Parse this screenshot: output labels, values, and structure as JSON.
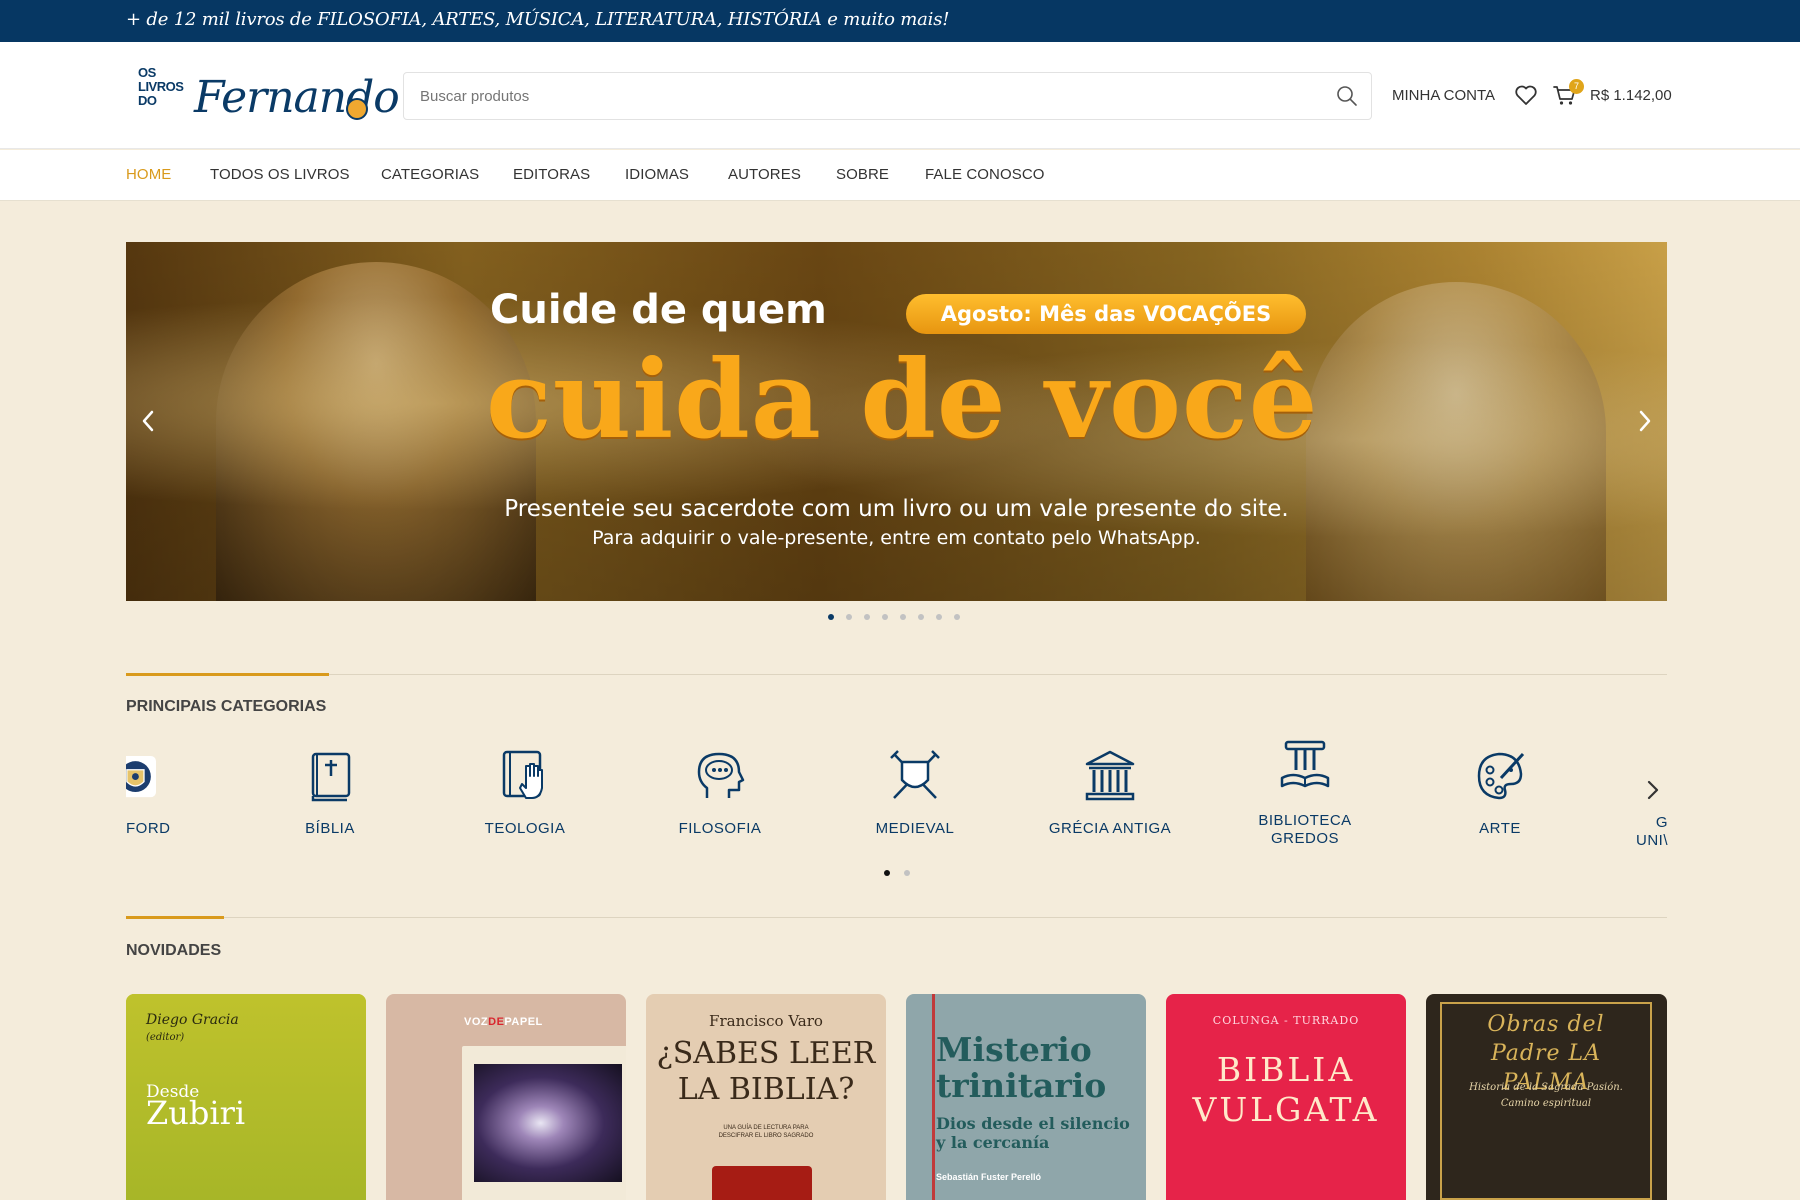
{
  "topbar": {
    "text": "+ de 12 mil livros de FILOSOFIA, ARTES, MÚSICA, LITERATURA, HISTÓRIA e muito mais!"
  },
  "logo": {
    "small": "OS LIVROS DO",
    "script": "Fernando"
  },
  "search": {
    "placeholder": "Buscar produtos",
    "value": ""
  },
  "header": {
    "account_label": "MINHA CONTA",
    "cart_count": "7",
    "cart_total": "R$ 1.142,00"
  },
  "nav": {
    "items": [
      {
        "label": "HOME",
        "active": true
      },
      {
        "label": "TODOS OS LIVROS"
      },
      {
        "label": "CATEGORIAS"
      },
      {
        "label": "EDITORAS"
      },
      {
        "label": "IDIOMAS"
      },
      {
        "label": "AUTORES"
      },
      {
        "label": "SOBRE"
      },
      {
        "label": "FALE CONOSCO"
      }
    ]
  },
  "hero": {
    "title_line1": "Cuide de quem",
    "pill": "Agosto: Mês das VOCAÇÕES",
    "title_line2": "cuida de você",
    "subtitle1": "Presenteie seu sacerdote com um livro ou um vale presente do site.",
    "subtitle2": "Para adquirir o vale-presente, entre em contato pelo WhatsApp.",
    "slide_count": 8,
    "active_slide": 1
  },
  "categories": {
    "title": "PRINCIPAIS CATEGORIAS",
    "items": [
      {
        "label": "FORD",
        "icon": "crest-icon"
      },
      {
        "label": "BÍBLIA",
        "icon": "bible-icon"
      },
      {
        "label": "TEOLOGIA",
        "icon": "book-hand-icon"
      },
      {
        "label": "FILOSOFIA",
        "icon": "head-thought-icon"
      },
      {
        "label": "MEDIEVAL",
        "icon": "shield-swords-icon"
      },
      {
        "label": "GRÉCIA ANTIGA",
        "icon": "temple-icon"
      },
      {
        "label": "BIBLIOTECA GREDOS",
        "icon": "column-books-icon"
      },
      {
        "label": "ARTE",
        "icon": "palette-icon"
      },
      {
        "label": "G UNI\\",
        "icon": "partial-icon"
      }
    ],
    "page_count": 2,
    "active_page": 1
  },
  "novidades": {
    "title": "NOVIDADES",
    "books": [
      {
        "author": "Diego Gracia",
        "editor": "(editor)",
        "title_small": "Desde",
        "title": "Zubiri",
        "bg": "#c3c22a"
      },
      {
        "publisher_left": "VOZ",
        "publisher_mid": "DE",
        "publisher_right": "PAPEL",
        "bg": "#d7b8a4"
      },
      {
        "author": "Francisco Varo",
        "title": "¿SABES LEER LA BIBLIA?",
        "subtitle": "UNA GUÍA DE LECTURA PARA DESCIFRAR EL LIBRO SAGRADO",
        "bg": "#e4cdb2"
      },
      {
        "title": "Misterio trinitario",
        "subtitle": "Dios desde el silencio y la cercanía",
        "author": "Sebastián Fuster Perelló",
        "bg": "#8fa6aa"
      },
      {
        "author": "COLUNGA - TURRADO",
        "title": "BIBLIA VULGATA",
        "bg": "#e62349"
      },
      {
        "title": "Obras del Padre LA PALMA",
        "subtitle": "Historia de la Sagrada Pasión. Camino espiritual",
        "bg": "#2e261c"
      }
    ]
  },
  "colors": {
    "navy": "#063763",
    "accent": "#d99a1c",
    "background": "#f4ecdb"
  }
}
